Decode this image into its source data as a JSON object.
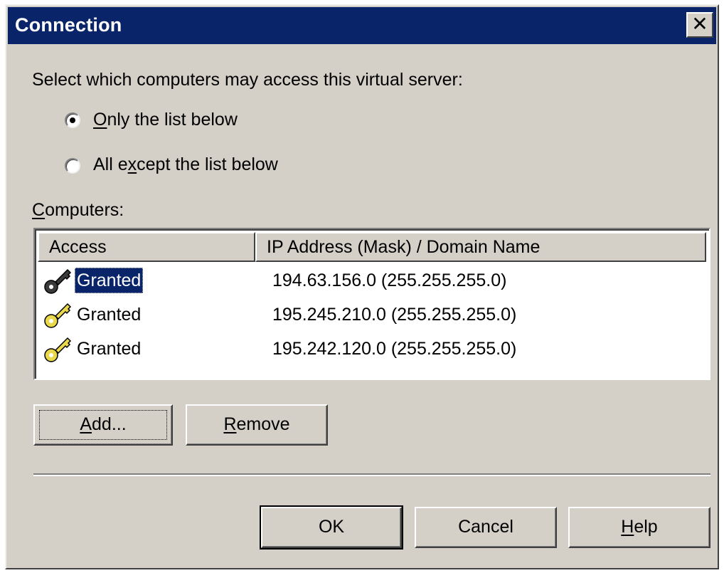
{
  "window": {
    "title": "Connection",
    "close_glyph": "✕"
  },
  "access": {
    "prompt": "Select which computers may access this virtual server:",
    "options": [
      {
        "pre": "",
        "key": "O",
        "post": "nly the list below",
        "selected": true
      },
      {
        "pre": "All e",
        "key": "x",
        "post": "cept the list below",
        "selected": false
      }
    ]
  },
  "computers": {
    "label_key": "C",
    "label_rest": "omputers:",
    "columns": {
      "access": "Access",
      "address": "IP Address (Mask) / Domain Name"
    },
    "rows": [
      {
        "access": "Granted",
        "address": "194.63.156.0 (255.255.255.0)",
        "icon": "key-icon",
        "selected": true
      },
      {
        "access": "Granted",
        "address": "195.245.210.0 (255.255.255.0)",
        "icon": "key-icon",
        "selected": false
      },
      {
        "access": "Granted",
        "address": "195.242.120.0 (255.255.255.0)",
        "icon": "key-icon",
        "selected": false
      }
    ]
  },
  "buttons": {
    "add": {
      "key": "A",
      "rest": "dd..."
    },
    "remove": {
      "key": "R",
      "rest": "emove"
    },
    "ok": "OK",
    "cancel": "Cancel",
    "help": {
      "key": "H",
      "rest": "elp"
    }
  },
  "colors": {
    "titlebar": "#0a246a",
    "face": "#d4d0c8",
    "selection": "#0a246a",
    "key_yellow": "#e8d84a",
    "key_dark": "#3a3a3a"
  }
}
